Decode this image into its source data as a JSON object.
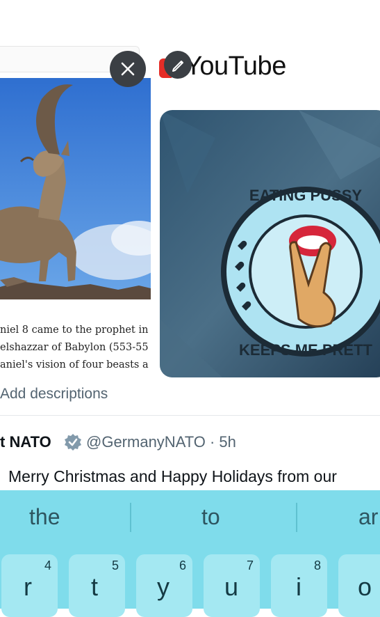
{
  "left_attachment": {
    "doc_lines": [
      "niel 8 came to the prophet in",
      "elshazzar of Babylon (553-55",
      "aniel's vision of four beasts a"
    ]
  },
  "right_attachment": {
    "brand_text": "YouTube",
    "pin_top_text": "EATING PUSSY",
    "pin_bottom_text": "KEEPS ME PRETT"
  },
  "add_descriptions_label": "Add descriptions",
  "tweet": {
    "name": "t NATO",
    "handle_time": "@GermanyNATO · 5h",
    "text": "Merry Christmas and Happy Holidays from our"
  },
  "keyboard": {
    "suggestions": [
      "the",
      "to",
      "ar"
    ],
    "keys": [
      {
        "letter": "r",
        "num": "4"
      },
      {
        "letter": "t",
        "num": "5"
      },
      {
        "letter": "y",
        "num": "6"
      },
      {
        "letter": "u",
        "num": "7"
      },
      {
        "letter": "i",
        "num": "8"
      },
      {
        "letter": "o",
        "num": ""
      }
    ]
  },
  "colors": {
    "keyboard_bg": "#7fdceb",
    "key_bg": "#a4e8f2",
    "verified_badge": "#829aab",
    "secondary_text": "#536471"
  }
}
